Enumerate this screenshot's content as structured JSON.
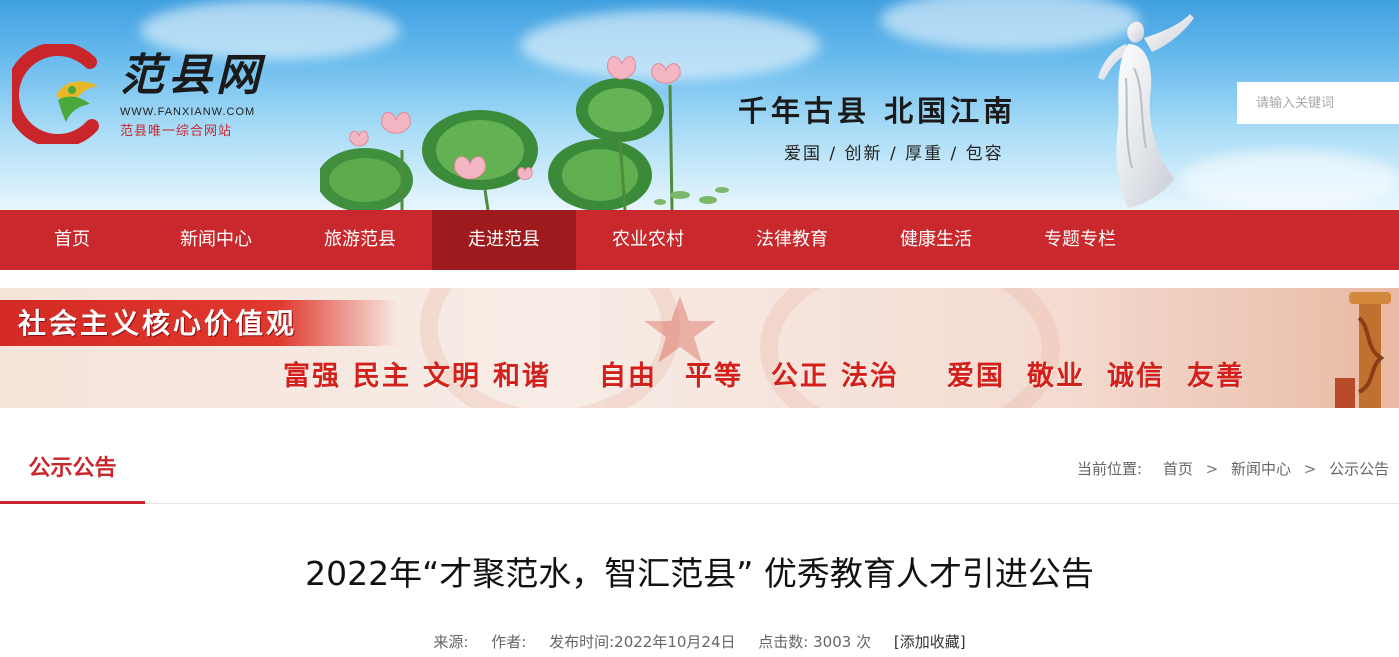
{
  "header": {
    "logo": {
      "title": "范县网",
      "url_text": "WWW.FANXIANW.COM",
      "subtitle": "范县唯一综合网站"
    },
    "slogan_main": "千年古县  北国江南",
    "slogan_sub": "爱国 / 创新 / 厚重 / 包容",
    "search": {
      "placeholder": "请输入关键词"
    }
  },
  "nav": {
    "items": [
      {
        "label": "首页"
      },
      {
        "label": "新闻中心"
      },
      {
        "label": "旅游范县"
      },
      {
        "label": "走进范县"
      },
      {
        "label": "农业农村"
      },
      {
        "label": "法律教育"
      },
      {
        "label": "健康生活"
      },
      {
        "label": "专题专栏"
      }
    ],
    "active_index": 3
  },
  "banner": {
    "title": "社会主义核心价值观",
    "values": [
      "富强",
      "民主",
      "文明",
      "和谐",
      "自由",
      "平等",
      "公正",
      "法治",
      "爱国",
      "敬业",
      "诚信",
      "友善"
    ]
  },
  "section": {
    "title": "公示公告",
    "breadcrumb": {
      "label": "当前位置:",
      "items": [
        "首页",
        "新闻中心",
        "公示公告"
      ],
      "separator": ">"
    }
  },
  "article": {
    "title": "2022年“才聚范水，智汇范县” 优秀教育人才引进公告",
    "meta": {
      "source_label": "来源:",
      "author_label": "作者:",
      "publish_label": "发布时间:",
      "publish_date": "2022年10月24日",
      "clicks_label": "点击数:",
      "clicks_value": "3003 次",
      "favorite": "[添加收藏]"
    }
  },
  "colors": {
    "brand_red": "#c9292c",
    "active_nav": "#9e1a1d",
    "banner_text_red": "#d4201b"
  }
}
